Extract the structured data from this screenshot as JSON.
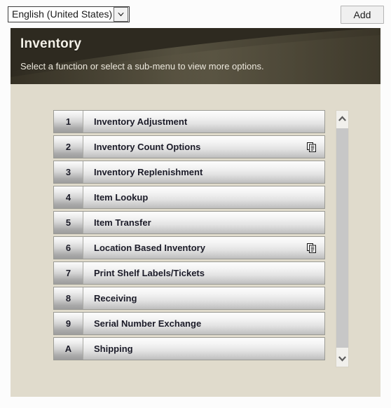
{
  "toolbar": {
    "language_select": {
      "value": "English (United States)",
      "icon": "chevron-down-icon"
    },
    "add_label": "Add"
  },
  "header": {
    "title": "Inventory",
    "subtitle": "Select a function or select a sub-menu to view more options."
  },
  "menu": {
    "items": [
      {
        "key": "1",
        "label": "Inventory Adjustment",
        "submenu": false,
        "icon": ""
      },
      {
        "key": "2",
        "label": "Inventory Count Options",
        "submenu": true,
        "icon": "submenu-documents-icon"
      },
      {
        "key": "3",
        "label": "Inventory Replenishment",
        "submenu": false,
        "icon": ""
      },
      {
        "key": "4",
        "label": "Item Lookup",
        "submenu": false,
        "icon": ""
      },
      {
        "key": "5",
        "label": "Item Transfer",
        "submenu": false,
        "icon": ""
      },
      {
        "key": "6",
        "label": "Location Based Inventory",
        "submenu": true,
        "icon": "submenu-documents-icon"
      },
      {
        "key": "7",
        "label": "Print Shelf Labels/Tickets",
        "submenu": false,
        "icon": ""
      },
      {
        "key": "8",
        "label": "Receiving",
        "submenu": false,
        "icon": ""
      },
      {
        "key": "9",
        "label": "Serial Number Exchange",
        "submenu": false,
        "icon": ""
      },
      {
        "key": "A",
        "label": "Shipping",
        "submenu": false,
        "icon": ""
      }
    ]
  },
  "scrollbar": {
    "up_icon": "chevron-up-icon",
    "down_icon": "chevron-down-icon"
  },
  "colors": {
    "header_background": "#2e2a20",
    "panel_background": "#e0dbcc",
    "page_background": "#fcfcfc",
    "item_text": "#1b1b28",
    "scroll_thumb": "#c7c7c7"
  }
}
